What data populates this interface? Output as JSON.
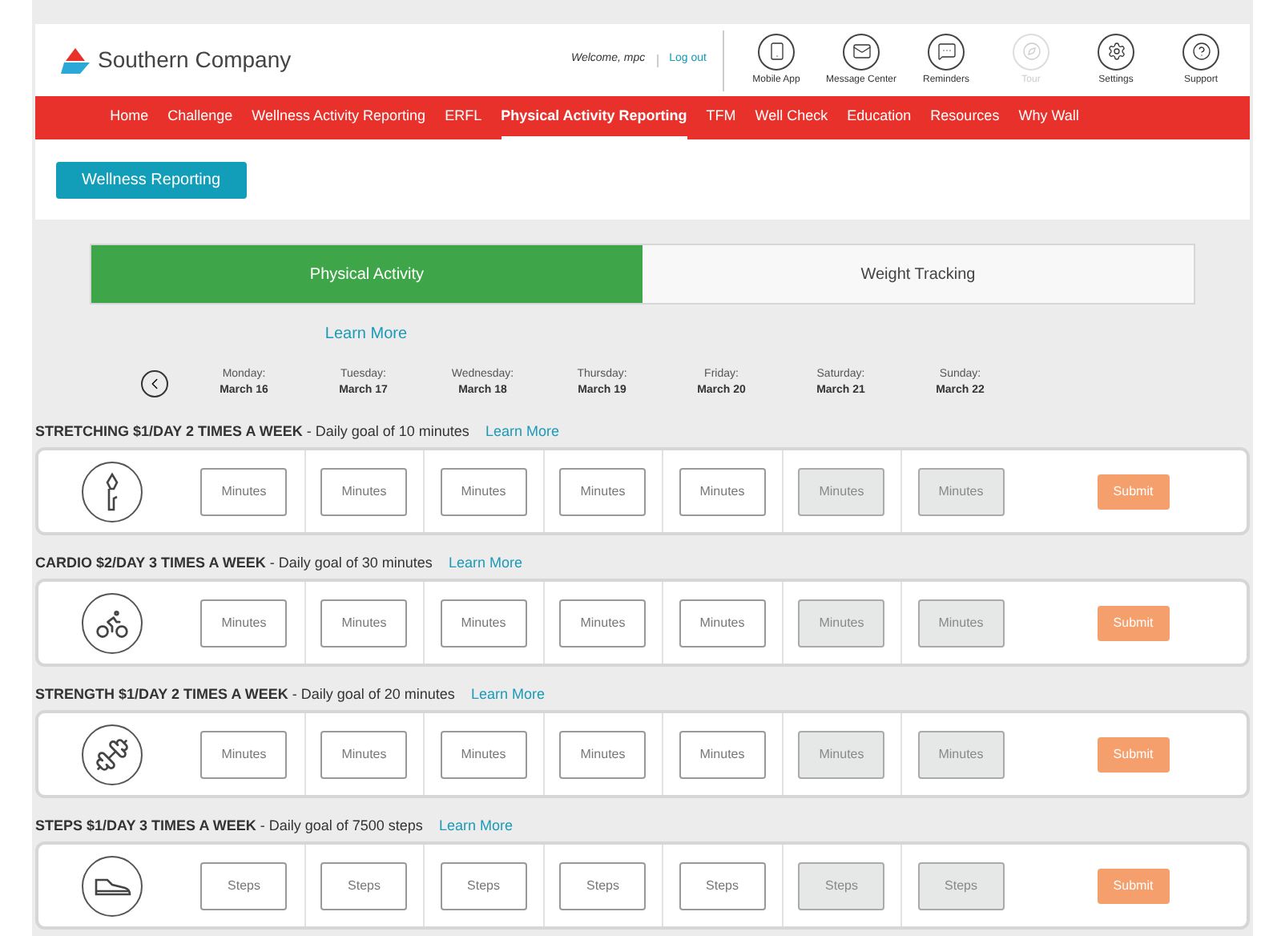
{
  "header": {
    "brand": "Southern Company",
    "welcome": "Welcome, mpc",
    "logout": "Log out",
    "tools": [
      {
        "kind": "phone",
        "label": "Mobile App",
        "disabled": false
      },
      {
        "kind": "mail",
        "label": "Message Center",
        "disabled": false
      },
      {
        "kind": "chat",
        "label": "Reminders",
        "disabled": false
      },
      {
        "kind": "compass",
        "label": "Tour",
        "disabled": true
      },
      {
        "kind": "gear",
        "label": "Settings",
        "disabled": false
      },
      {
        "kind": "help",
        "label": "Support",
        "disabled": false
      }
    ]
  },
  "nav": [
    {
      "label": "Home",
      "selected": false
    },
    {
      "label": "Challenge",
      "selected": false
    },
    {
      "label": "Wellness Activity Reporting",
      "selected": false
    },
    {
      "label": "ERFL",
      "selected": false
    },
    {
      "label": "Physical Activity Reporting",
      "selected": true
    },
    {
      "label": "TFM",
      "selected": false
    },
    {
      "label": "Well Check",
      "selected": false
    },
    {
      "label": "Education",
      "selected": false
    },
    {
      "label": "Resources",
      "selected": false
    },
    {
      "label": "Why Wall",
      "selected": false
    }
  ],
  "wellness_button": "Wellness Reporting",
  "tabs": [
    {
      "label": "Physical Activity",
      "selected": true
    },
    {
      "label": "Weight Tracking",
      "selected": false
    }
  ],
  "learn_more": "Learn More",
  "days": [
    {
      "day": "Monday:",
      "date": "March 16"
    },
    {
      "day": "Tuesday:",
      "date": "March 17"
    },
    {
      "day": "Wednesday:",
      "date": "March 18"
    },
    {
      "day": "Thursday:",
      "date": "March 19"
    },
    {
      "day": "Friday:",
      "date": "March 20"
    },
    {
      "day": "Saturday:",
      "date": "March 21"
    },
    {
      "day": "Sunday:",
      "date": "March 22"
    }
  ],
  "activities": [
    {
      "kind": "torch",
      "title": "STRETCHING $1/DAY 2 TIMES A WEEK",
      "goal": " - Daily goal of 10 minutes",
      "learn_more": "Learn More",
      "submit": "Submit",
      "entries": [
        {
          "placeholder": "Minutes",
          "disabled": false
        },
        {
          "placeholder": "Minutes",
          "disabled": false
        },
        {
          "placeholder": "Minutes",
          "disabled": false
        },
        {
          "placeholder": "Minutes",
          "disabled": false
        },
        {
          "placeholder": "Minutes",
          "disabled": false
        },
        {
          "placeholder": "Minutes",
          "disabled": true
        },
        {
          "placeholder": "Minutes",
          "disabled": true
        }
      ]
    },
    {
      "kind": "bike",
      "title": "CARDIO $2/DAY 3 TIMES A WEEK",
      "goal": " - Daily goal of 30 minutes",
      "learn_more": "Learn More",
      "submit": "Submit",
      "entries": [
        {
          "placeholder": "Minutes",
          "disabled": false
        },
        {
          "placeholder": "Minutes",
          "disabled": false
        },
        {
          "placeholder": "Minutes",
          "disabled": false
        },
        {
          "placeholder": "Minutes",
          "disabled": false
        },
        {
          "placeholder": "Minutes",
          "disabled": false
        },
        {
          "placeholder": "Minutes",
          "disabled": true
        },
        {
          "placeholder": "Minutes",
          "disabled": true
        }
      ]
    },
    {
      "kind": "dumbbell",
      "title": "STRENGTH $1/DAY 2 TIMES A WEEK",
      "goal": " - Daily goal of 20 minutes",
      "learn_more": "Learn More",
      "submit": "Submit",
      "entries": [
        {
          "placeholder": "Minutes",
          "disabled": false
        },
        {
          "placeholder": "Minutes",
          "disabled": false
        },
        {
          "placeholder": "Minutes",
          "disabled": false
        },
        {
          "placeholder": "Minutes",
          "disabled": false
        },
        {
          "placeholder": "Minutes",
          "disabled": false
        },
        {
          "placeholder": "Minutes",
          "disabled": true
        },
        {
          "placeholder": "Minutes",
          "disabled": true
        }
      ]
    },
    {
      "kind": "shoe",
      "title": "STEPS $1/DAY 3 TIMES A WEEK",
      "goal": " - Daily goal of 7500 steps",
      "learn_more": "Learn More",
      "submit": "Submit",
      "entries": [
        {
          "placeholder": "Steps",
          "disabled": false
        },
        {
          "placeholder": "Steps",
          "disabled": false
        },
        {
          "placeholder": "Steps",
          "disabled": false
        },
        {
          "placeholder": "Steps",
          "disabled": false
        },
        {
          "placeholder": "Steps",
          "disabled": false
        },
        {
          "placeholder": "Steps",
          "disabled": true
        },
        {
          "placeholder": "Steps",
          "disabled": true
        }
      ]
    }
  ]
}
